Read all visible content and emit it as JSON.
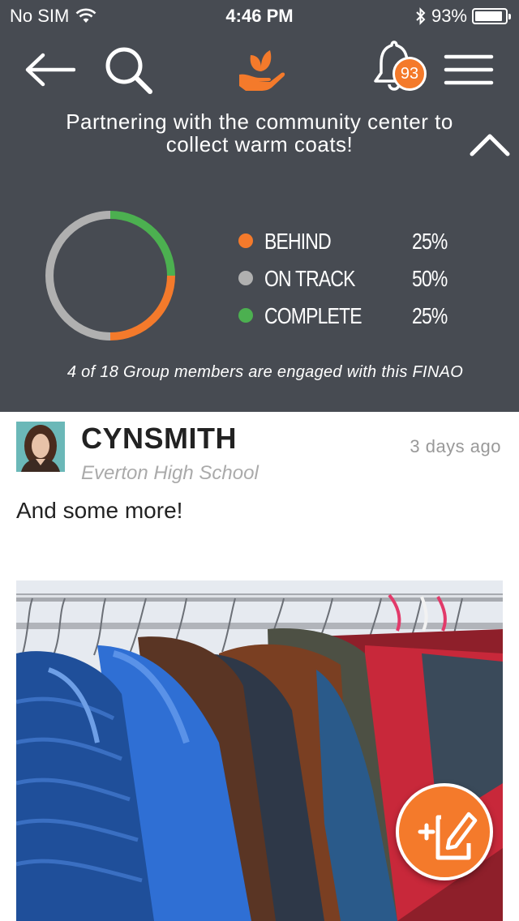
{
  "status_bar": {
    "carrier": "No SIM",
    "time": "4:46 PM",
    "battery_percent": "93%",
    "battery_level": 0.93
  },
  "nav": {
    "back_icon": "arrow-left-icon",
    "search_icon": "search-icon",
    "logo_icon": "hand-with-sprout-logo",
    "notifications_icon": "bell-icon",
    "notification_count": "93",
    "menu_icon": "hamburger-menu-icon"
  },
  "goal": {
    "title": "Partnering with the community center to collect warm coats!",
    "collapse_icon": "chevron-up-icon",
    "engaged_text": "4 of 18 Group members are engaged with this FINAO"
  },
  "progress": {
    "items": [
      {
        "label": "BEHIND",
        "value": "25%",
        "fraction": 0.25,
        "color": "#f47a2b"
      },
      {
        "label": "ON TRACK",
        "value": "50%",
        "fraction": 0.5,
        "color": "#b0b0b0"
      },
      {
        "label": "COMPLETE",
        "value": "25%",
        "fraction": 0.25,
        "color": "#4cb050"
      }
    ]
  },
  "post": {
    "username": "CYNSMITH",
    "time_ago": "3 days ago",
    "school": "Everton High School",
    "text": "And some more!"
  },
  "fab": {
    "icon": "add-post-edit-icon"
  },
  "colors": {
    "header_bg": "#474b52",
    "accent": "#f47a2b"
  }
}
